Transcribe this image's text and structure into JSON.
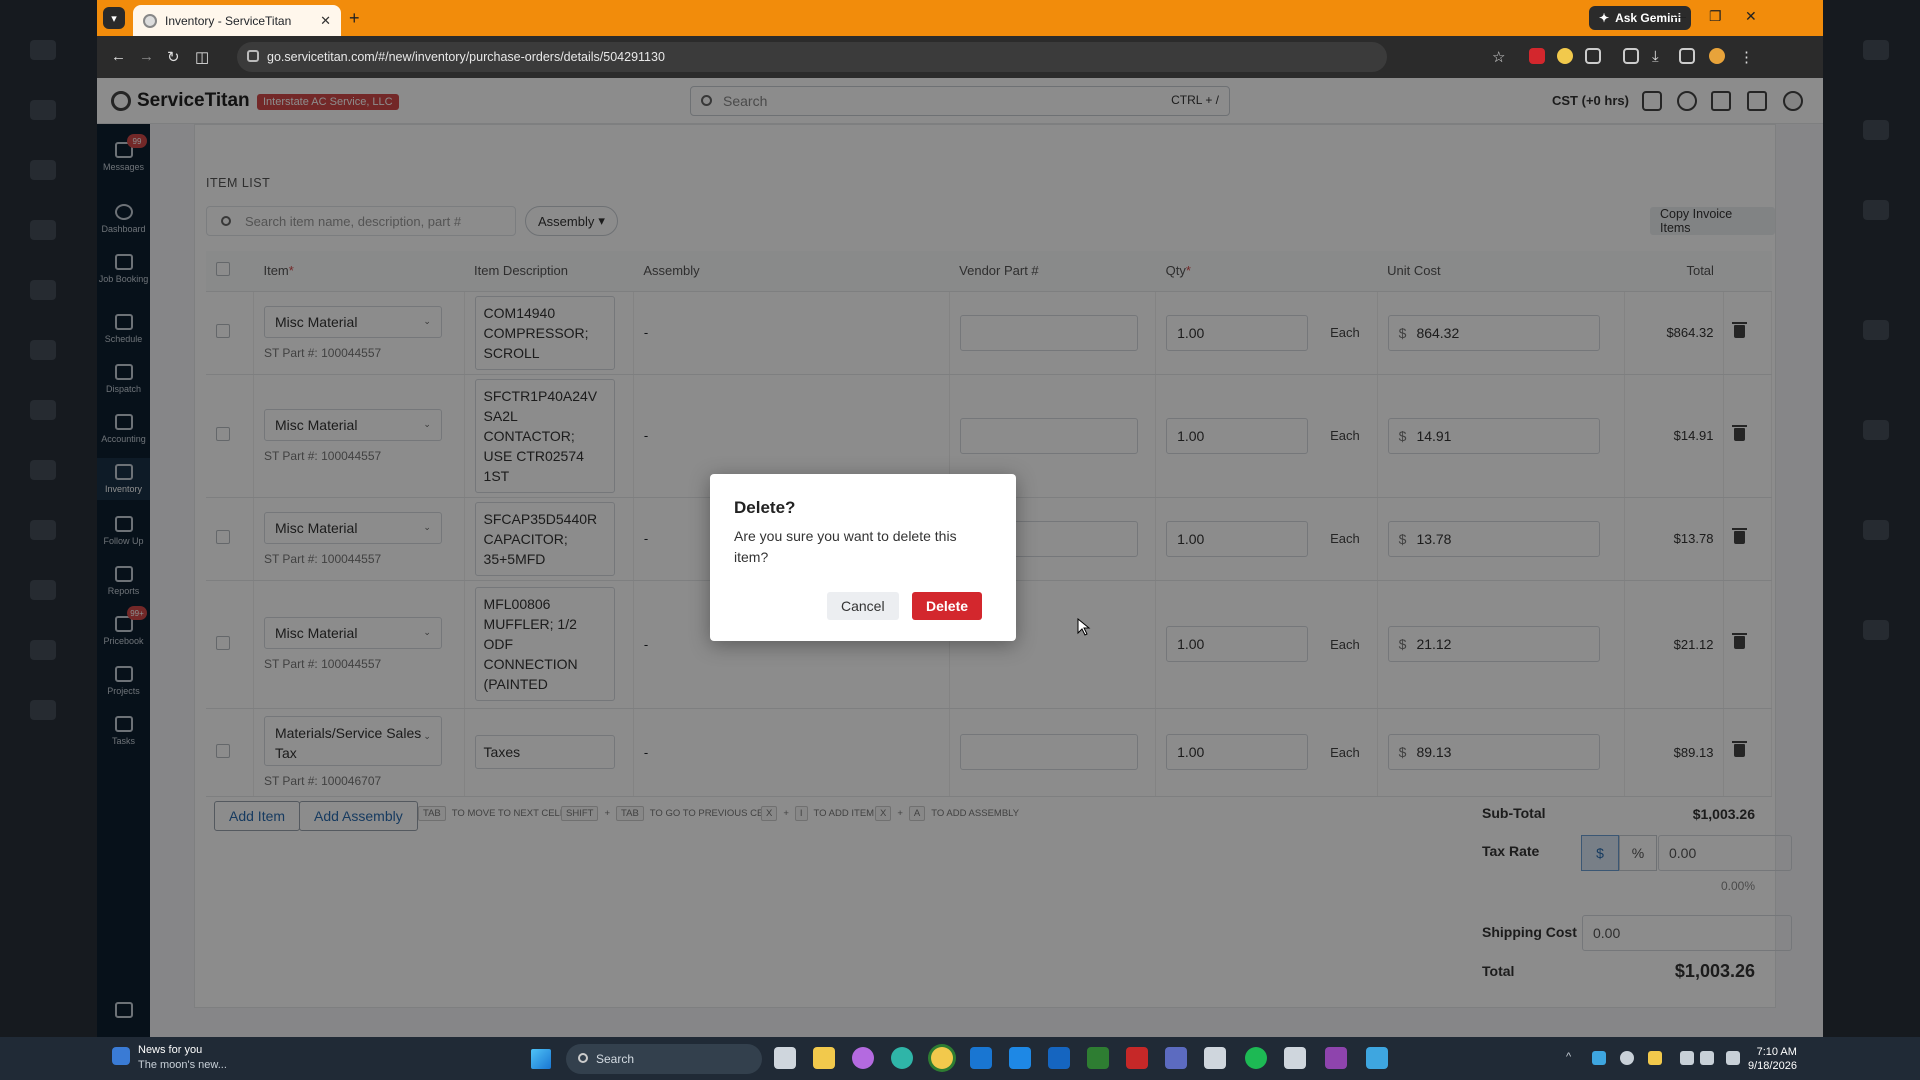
{
  "browser": {
    "tab_title": "Inventory - ServiceTitan",
    "ask_gemini": "Ask Gemini",
    "url": "go.servicetitan.com/#/new/inventory/purchase-orders/details/504291130"
  },
  "app": {
    "brand": "ServiceTitan",
    "company": "Interstate AC Service, LLC",
    "search_placeholder": "Search",
    "search_shortcut": "CTRL + /",
    "timezone": "CST (+0 hrs)"
  },
  "sidebar": {
    "items": [
      {
        "label": "Messages",
        "badge": "99"
      },
      {
        "label": "Dashboard"
      },
      {
        "label": "Job Booking"
      },
      {
        "label": "Schedule"
      },
      {
        "label": "Dispatch"
      },
      {
        "label": "Accounting"
      },
      {
        "label": "Inventory"
      },
      {
        "label": "Follow Up"
      },
      {
        "label": "Reports"
      },
      {
        "label": "Pricebook",
        "badge": "99+"
      },
      {
        "label": "Projects"
      },
      {
        "label": "Tasks"
      }
    ]
  },
  "item_list": {
    "title": "ITEM LIST",
    "search_placeholder": "Search item name, description, part #",
    "assembly_filter": "Assembly",
    "copy_invoice_items": "Copy Invoice Items",
    "columns": {
      "item": "Item",
      "item_description": "Item Description",
      "assembly": "Assembly",
      "vendor_part": "Vendor Part #",
      "qty": "Qty",
      "unit_cost": "Unit Cost",
      "total": "Total"
    },
    "rows": [
      {
        "item": "Misc Material",
        "st_part": "ST Part #: 100044557",
        "description": "COM14940 COMPRESSOR; SCROLL",
        "assembly": "-",
        "qty": "1.00",
        "unit": "Each",
        "currency": "$",
        "unit_cost": "864.32",
        "total": "$864.32"
      },
      {
        "item": "Misc Material",
        "st_part": "ST Part #: 100044557",
        "description": "SFCTR1P40A24V SA2L CONTACTOR; USE CTR02574 1ST",
        "assembly": "-",
        "qty": "1.00",
        "unit": "Each",
        "currency": "$",
        "unit_cost": "14.91",
        "total": "$14.91"
      },
      {
        "item": "Misc Material",
        "st_part": "ST Part #: 100044557",
        "description": "SFCAP35D5440R CAPACITOR; 35+5MFD",
        "assembly": "-",
        "qty": "1.00",
        "unit": "Each",
        "currency": "$",
        "unit_cost": "13.78",
        "total": "$13.78"
      },
      {
        "item": "Misc Material",
        "st_part": "ST Part #: 100044557",
        "description": "MFL00806 MUFFLER; 1/2 ODF CONNECTION (PAINTED",
        "assembly": "-",
        "qty": "1.00",
        "unit": "Each",
        "currency": "$",
        "unit_cost": "21.12",
        "total": "$21.12"
      },
      {
        "item": "Materials/Service Sales Tax",
        "st_part": "ST Part #: 100046707",
        "description": "Taxes",
        "assembly": "-",
        "qty": "1.00",
        "unit": "Each",
        "currency": "$",
        "unit_cost": "89.13",
        "total": "$89.13"
      }
    ],
    "add_item": "Add Item",
    "add_assembly": "Add Assembly",
    "hints": {
      "tab": "TAB",
      "to_next": "TO MOVE TO NEXT CELL",
      "shift": "SHIFT",
      "plus": "+",
      "to_prev": "TO GO TO PREVIOUS CELL",
      "x": "X",
      "i": "I",
      "to_add_item": "TO ADD ITEM",
      "a": "A",
      "to_add_assembly": "TO ADD ASSEMBLY"
    }
  },
  "summary": {
    "subtotal_label": "Sub-Total",
    "subtotal_value": "$1,003.26",
    "tax_rate_label": "Tax Rate",
    "tax_dollar": "$",
    "tax_percent": "%",
    "tax_value": "0.00",
    "tax_percent_value": "0.00%",
    "shipping_label": "Shipping Cost",
    "shipping_value": "0.00",
    "total_label": "Total",
    "total_value": "$1,003.26"
  },
  "dialog": {
    "title": "Delete?",
    "message": "Are you sure you want to delete this item?",
    "cancel": "Cancel",
    "delete": "Delete"
  },
  "taskbar": {
    "news_title": "News for you",
    "news_sub": "The moon's new...",
    "search": "Search",
    "time": "7:10 AM",
    "date": "9/18/2026"
  },
  "colors": {
    "tab_bar": "#f28c0b",
    "sidebar": "#0d1f30",
    "delete_button": "#d3272d",
    "company_badge": "#d14a4a"
  }
}
